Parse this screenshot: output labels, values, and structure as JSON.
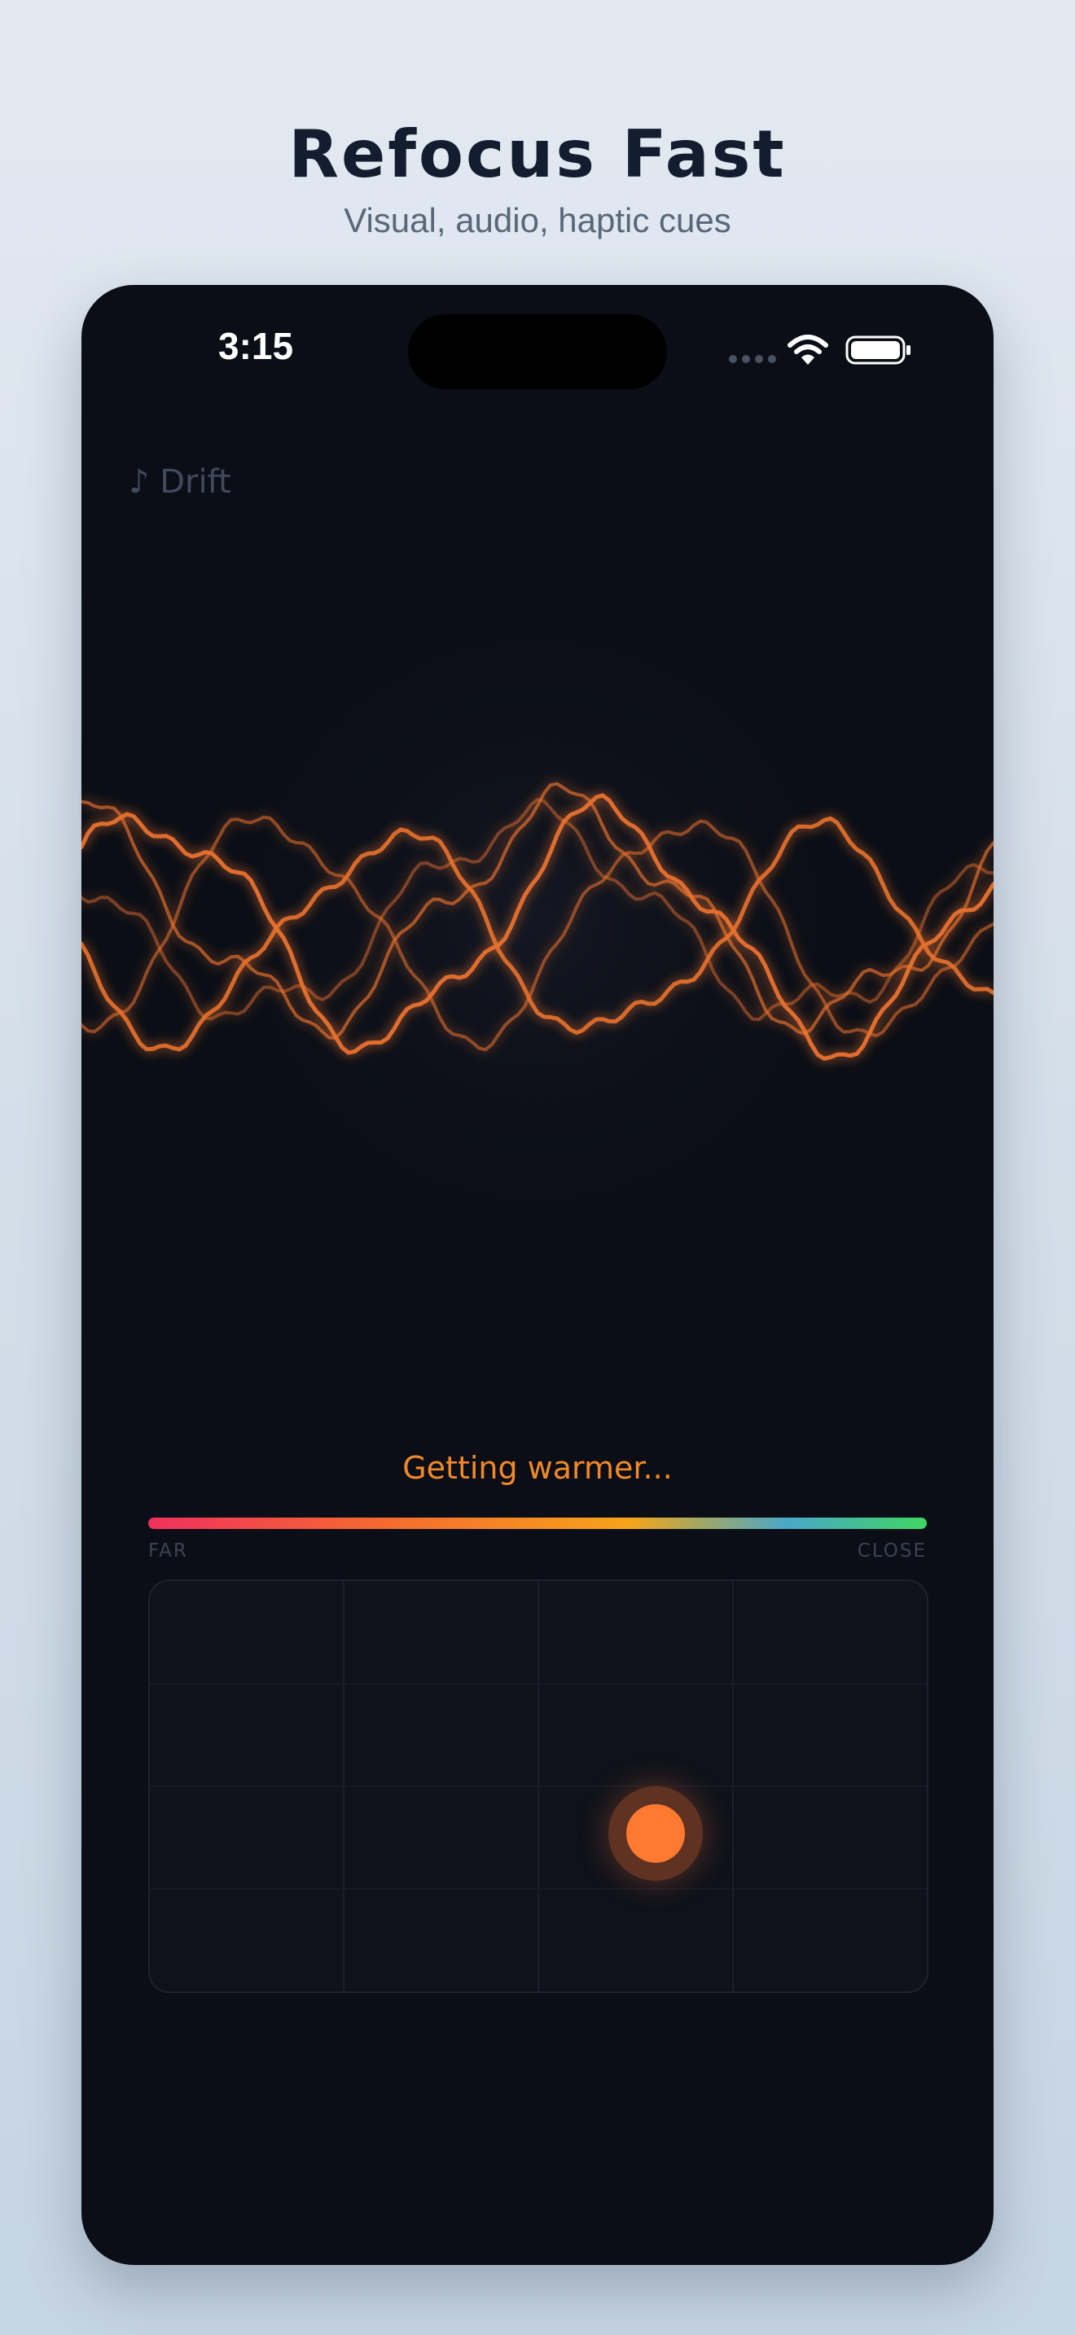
{
  "header": {
    "title": "Refocus Fast",
    "subtitle": "Visual, audio, haptic cues"
  },
  "status_bar": {
    "time": "3:15",
    "icons": [
      "signal-icon",
      "wifi-icon",
      "battery-icon"
    ]
  },
  "sound": {
    "label": "♪ Drift"
  },
  "feedback": {
    "message": "Getting warmer...",
    "scale_min_label": "FAR",
    "scale_max_label": "CLOSE"
  },
  "colors": {
    "accent": "#f0892a",
    "wave": "#e8712e",
    "knob": "#ff7a30",
    "background": "#0b0e16",
    "meter_gradient": [
      "#f0305e",
      "#f56a2f",
      "#f6a41a",
      "#4aa7c8",
      "#3ed662"
    ]
  }
}
